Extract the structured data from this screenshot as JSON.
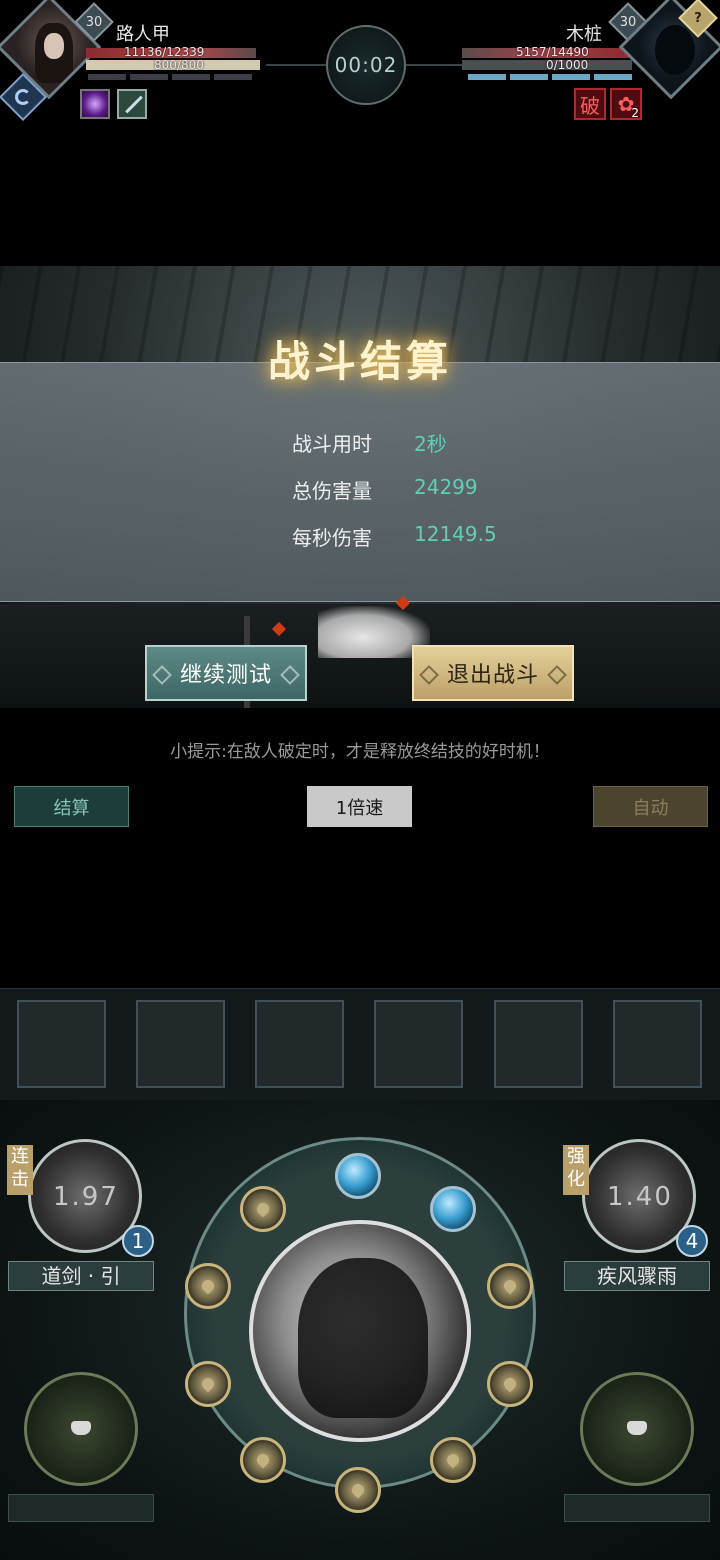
{
  "player": {
    "name": "路人甲",
    "level": "30",
    "hp_text": "11136/12339",
    "mp_text": "800/800",
    "hp_fraction": 0.9,
    "mp_fraction": 1.0
  },
  "enemy": {
    "name": "木桩",
    "level": "30",
    "unknown_badge": "?",
    "hp_text": "5157/14490",
    "mp_text": "0/1000",
    "hp_fraction": 0.356,
    "mp_fraction": 0,
    "debuffs": [
      {
        "glyph": "破",
        "count": ""
      },
      {
        "glyph": "",
        "count": "2"
      }
    ]
  },
  "timer": "00:02",
  "result": {
    "title": "战斗结算",
    "rows": [
      {
        "label": "战斗用时",
        "value": "2秒"
      },
      {
        "label": "总伤害量",
        "value": "24299"
      },
      {
        "label": "每秒伤害",
        "value": "12149.5"
      }
    ],
    "continue_label": "继续测试",
    "exit_label": "退出战斗"
  },
  "tip": "小提示:在敌人破定时，才是释放终结技的好时机！",
  "toolbar": {
    "settle_label": "结算",
    "speed_label": "1倍速",
    "auto_label": "自动"
  },
  "skills": {
    "left": {
      "tag": "连击",
      "cooldown": "1.97",
      "charges": "1",
      "name": "道剑 · 引"
    },
    "right": {
      "tag": "强化",
      "cooldown": "1.40",
      "charges": "4",
      "name": "疾风骤雨"
    }
  },
  "colors": {
    "accent_teal": "#5fcfb6",
    "gold": "#e3d09a",
    "hp_red": "#b3464d"
  }
}
